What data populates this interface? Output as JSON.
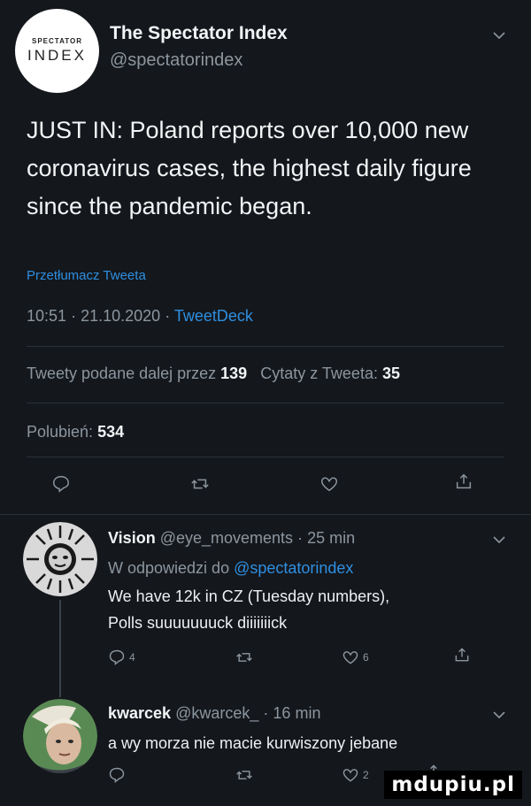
{
  "tweet": {
    "author": {
      "name": "The Spectator Index",
      "handle": "@spectatorindex",
      "avatar_line1": "SPECTATOR",
      "avatar_line2": "INDEX"
    },
    "text": "JUST IN: Poland reports over 10,000 new coronavirus cases, the highest daily figure since the pandemic began.",
    "translate_label": "Przetłumacz Tweeta",
    "time": "10:51",
    "date": "21.10.2020",
    "source": "TweetDeck",
    "separator": "·",
    "retweets_label": "Tweety podane dalej przez",
    "retweets_count": "139",
    "quotes_label": "Cytaty z Tweeta:",
    "quotes_count": "35",
    "likes_label": "Polubień:",
    "likes_count": "534"
  },
  "replies": [
    {
      "name": "Vision",
      "handle": "@eye_movements",
      "separator": "·",
      "time": "25 min",
      "reply_to_label": "W odpowiedzi do",
      "reply_to_handle": "@spectatorindex",
      "line1": "We have 12k in CZ (Tuesday numbers),",
      "line2": "Polls suuuuuuuck diiiiiiick",
      "reply_count": "4",
      "like_count": "6"
    },
    {
      "name": "kwarcek",
      "handle": "@kwarcek_",
      "separator": "·",
      "time": "16 min",
      "line1": "a wy morza nie macie kurwiszony jebane",
      "like_count": "2"
    }
  ],
  "watermark": "mdupiu.pl",
  "colors": {
    "background": "#14171c",
    "link": "#2f8fe0",
    "muted": "#8c969f"
  },
  "icons": [
    "chevron-down-icon",
    "reply-icon",
    "retweet-icon",
    "like-icon",
    "share-icon"
  ]
}
